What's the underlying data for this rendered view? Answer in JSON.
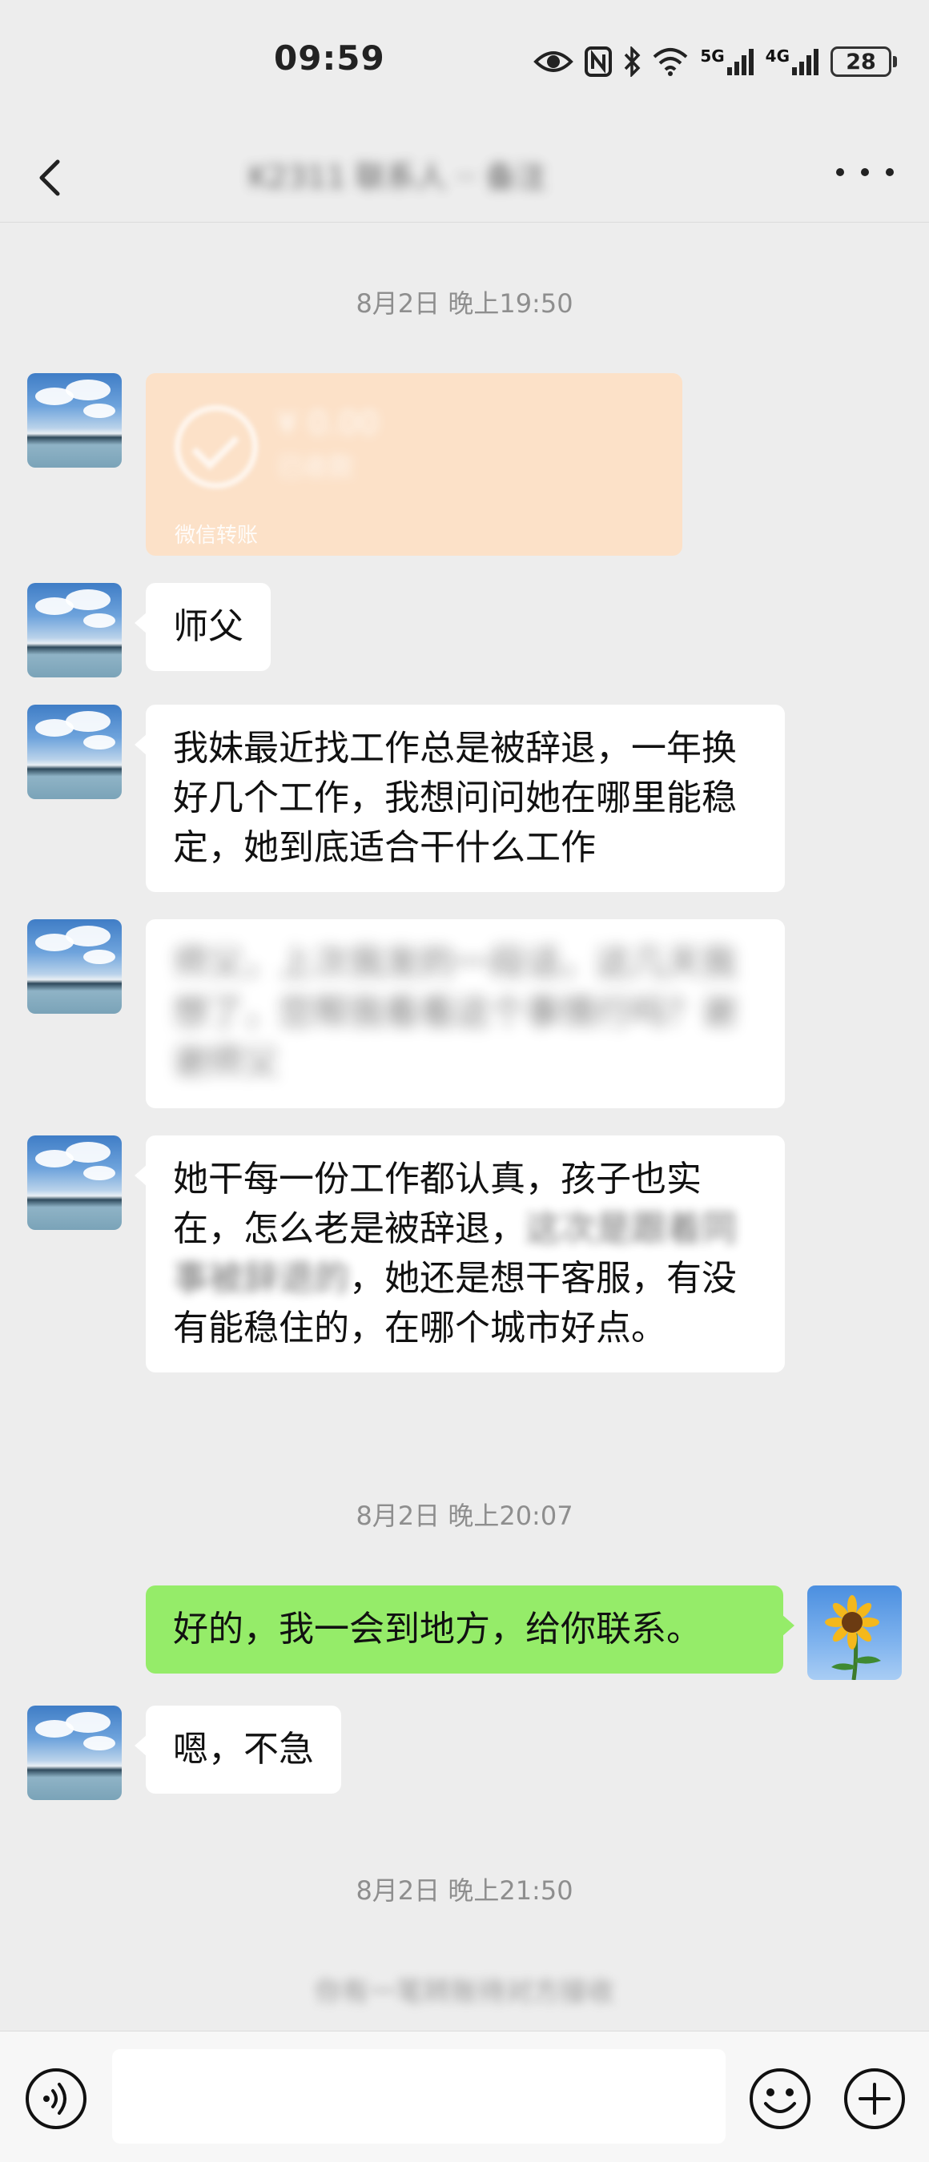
{
  "status_bar": {
    "time": "09:59",
    "network_1": "5G",
    "network_2": "4G",
    "battery": "28"
  },
  "header": {
    "back_label": "<",
    "title": "K2311 联系人 ·· 备注",
    "more_label": "···"
  },
  "messages": {
    "ts_1": "8月2日 晚上19:50",
    "transfer": {
      "amount": "¥ 0.00",
      "status": "已收款",
      "label": "微信转账"
    },
    "msg_1": "师父",
    "msg_2": "我妹最近找工作总是被辞退，一年换好几个工作，我想问问她在哪里能稳定，她到底适合干什么工作",
    "msg_3": "师父，上次我发的一段话，这几天我想了，您帮我看看这个事情行吗？谢谢师父",
    "msg_4_line_a": "她干每一份工作都认真，孩子也实在，怎么老是被辞退，",
    "msg_4_blur": "这次是跟着同事被辞退的",
    "msg_4_line_b": "，她还是想干客服，有没有能稳住的，在哪个城市好点。",
    "ts_2": "8月2日 晚上20:07",
    "msg_5": "好的，我一会到地方，给你联系。",
    "msg_6": "嗯，不急",
    "ts_3": "8月2日 晚上21:50",
    "notice": "你有一笔转账待对方接收"
  },
  "input_bar": {
    "placeholder": ""
  },
  "colors": {
    "background": "#ededed",
    "bubble_self": "#95ec69",
    "bubble_other": "#ffffff",
    "transfer_card": "#fce1c8"
  },
  "icons": {
    "back": "chevron-left-icon",
    "more": "more-dots-icon",
    "voice": "voice-icon",
    "emoji": "emoji-icon",
    "plus": "plus-icon"
  }
}
